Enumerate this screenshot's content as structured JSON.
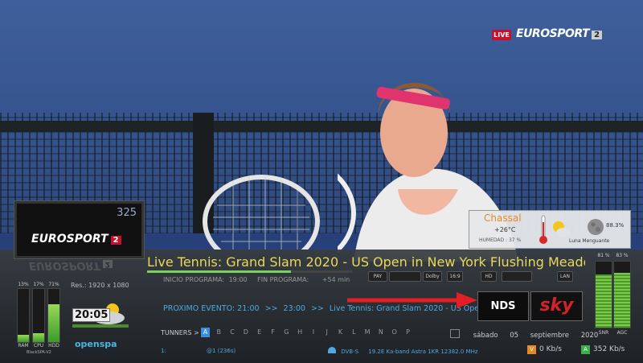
{
  "overlay": {
    "live_label": "LIVE",
    "top_logo": "EUROSPORT",
    "top_logo_num": "2"
  },
  "channel": {
    "number": "325",
    "logo": "EUROSPORT",
    "logo_num": "2"
  },
  "event": {
    "title": "Live Tennis: Grand Slam 2020 - US Open in New York Flushing Meadows",
    "start_label": "INICIO PROGRAMA:",
    "start_time": "19:00",
    "end_label": "FIN PROGRAMA:",
    "remaining": "+54 min",
    "progress": 0.7,
    "badges": [
      "PAY",
      "",
      "Dolby",
      "16:9",
      "HD",
      "",
      "LAN"
    ]
  },
  "resolution": "Res.: 1920 x 1080",
  "next_event": {
    "label": "PROXIMO EVENTO:",
    "start": "21:00",
    "sep1": ">>",
    "end": "23:00",
    "sep2": ">>",
    "title": "Live Tennis: Grand Slam 2020 - US Open"
  },
  "clock": "20:05",
  "tuners": {
    "label": "TUNNERS >",
    "items": [
      "A",
      "B",
      "C",
      "D",
      "E",
      "F",
      "G",
      "H",
      "I",
      "J",
      "K",
      "L",
      "M",
      "N",
      "O",
      "P"
    ],
    "active": "A"
  },
  "date": {
    "weekday": "sábado",
    "day": "05",
    "month": "septiembre",
    "year": "2020"
  },
  "service": {
    "index": "1:",
    "code": "@1 (236s)"
  },
  "satellite": {
    "system": "DVB-S",
    "details": "19.2E Ka-band Astra 1KR 12382.0 MHz"
  },
  "bitrate": {
    "video_icon": "V",
    "video": "0 Kb/s",
    "audio_icon": "A",
    "audio": "352 Kb/s"
  },
  "meters": {
    "ram": {
      "label": "RAM",
      "pct": "13%",
      "value": 13
    },
    "cpu": {
      "label": "CPU",
      "pct": "17%",
      "value": 17
    },
    "hdd": {
      "label": "HDD",
      "pct": "71%",
      "value": 71
    },
    "snr": {
      "label": "SNR",
      "pct": "81 %",
      "value": 81
    },
    "agc": {
      "label": "AGC",
      "pct": "83 %",
      "value": 83
    }
  },
  "brand": "openspa",
  "skin_name": "BlackSPA-V2",
  "providers": [
    "NDS",
    "sky"
  ],
  "weather": {
    "city": "Chassal",
    "temp": "+26°C",
    "humidity": "HUMEDAD :   37 %",
    "moon_pct": "88.3%",
    "moon_label": "Luna Menguante",
    "icons": [
      "thermometer-icon",
      "sun-cloud-icon",
      "moon-icon"
    ]
  },
  "colors": {
    "title": "#e8d85c",
    "accent_blue": "#4fa8e0",
    "eurosport_red": "#c8102e",
    "meter_green": "#7bc84a"
  }
}
